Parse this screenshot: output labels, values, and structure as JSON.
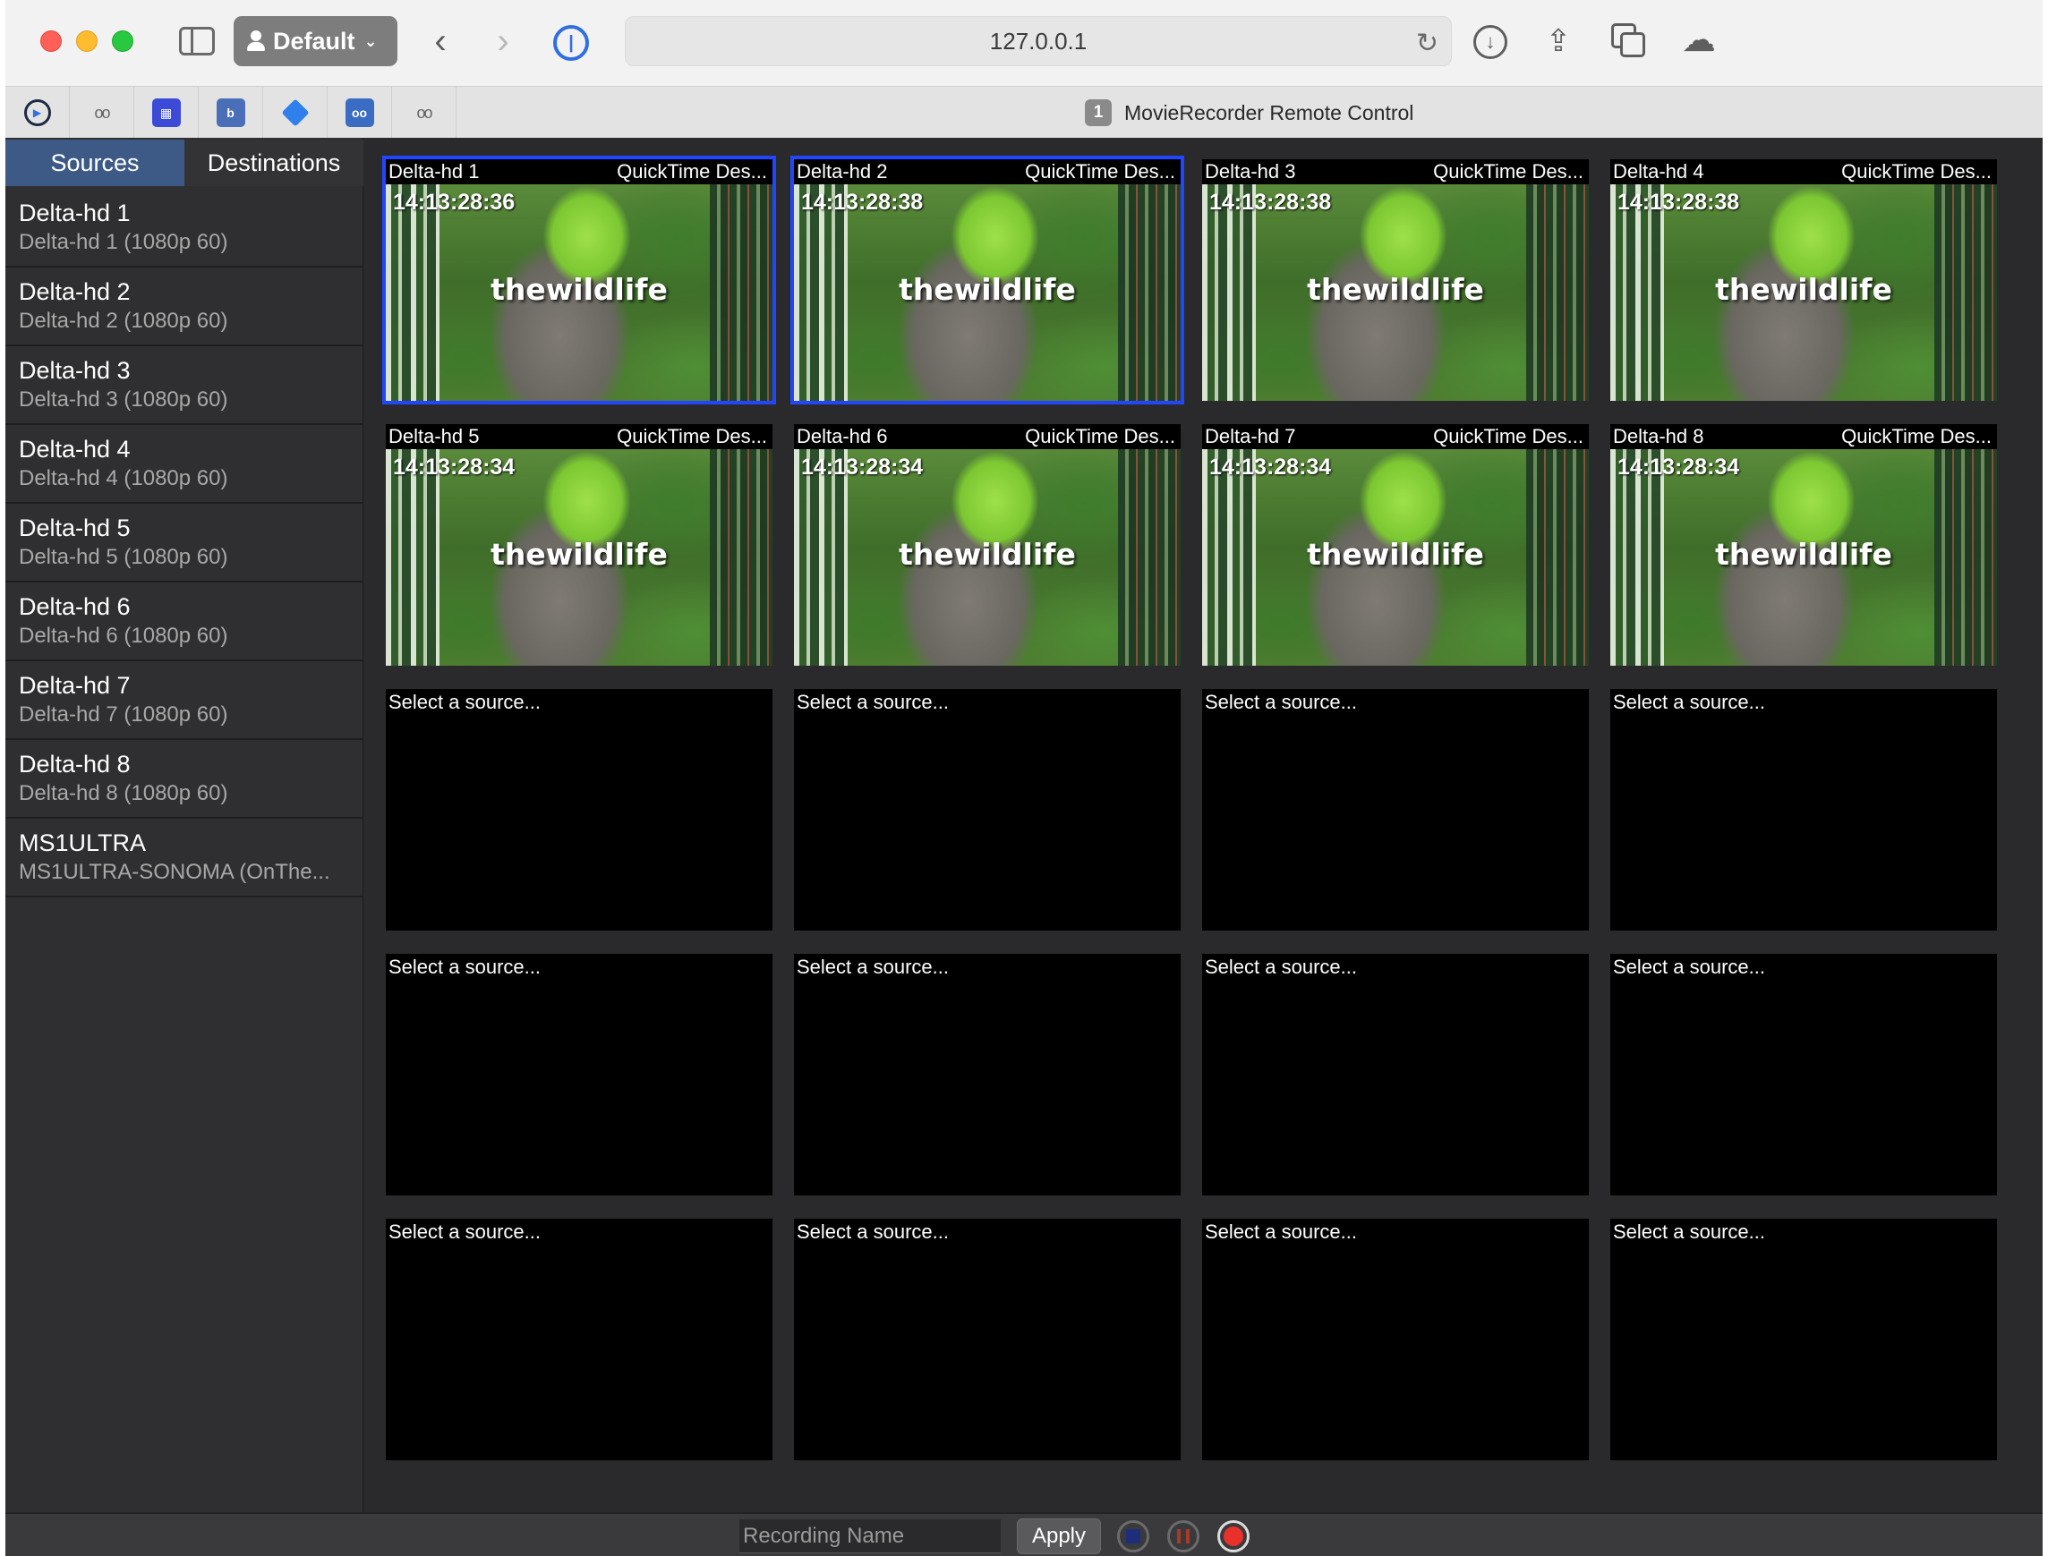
{
  "browser": {
    "profile": "Default",
    "url": "127.0.0.1"
  },
  "tab": {
    "badge": "1",
    "title": "MovieRecorder Remote Control"
  },
  "pinned_tabs": [
    {
      "icon": "play-circle-icon"
    },
    {
      "icon": "dots-icon"
    },
    {
      "icon": "grid-app-icon"
    },
    {
      "icon": "b-app-icon"
    },
    {
      "icon": "diamond-icon"
    },
    {
      "icon": "dots-box-icon"
    },
    {
      "icon": "dots-icon"
    }
  ],
  "sidebar": {
    "tabs": {
      "sources": "Sources",
      "destinations": "Destinations"
    },
    "items": [
      {
        "name": "Delta-hd 1",
        "sub": "Delta-hd 1 (1080p 60)"
      },
      {
        "name": "Delta-hd 2",
        "sub": "Delta-hd 2 (1080p 60)"
      },
      {
        "name": "Delta-hd 3",
        "sub": "Delta-hd 3 (1080p 60)"
      },
      {
        "name": "Delta-hd 4",
        "sub": "Delta-hd 4 (1080p 60)"
      },
      {
        "name": "Delta-hd 5",
        "sub": "Delta-hd 5 (1080p 60)"
      },
      {
        "name": "Delta-hd 6",
        "sub": "Delta-hd 6 (1080p 60)"
      },
      {
        "name": "Delta-hd 7",
        "sub": "Delta-hd 7 (1080p 60)"
      },
      {
        "name": "Delta-hd 8",
        "sub": "Delta-hd 8 (1080p 60)"
      },
      {
        "name": "MS1ULTRA",
        "sub": "MS1ULTRA-SONOMA (OnThe..."
      }
    ]
  },
  "grid": {
    "active_cells": [
      {
        "source": "Delta-hd 1",
        "dest": "QuickTime Des...",
        "timecode": "14:13:28:36",
        "watermark": "thewildlife",
        "selected": true
      },
      {
        "source": "Delta-hd 2",
        "dest": "QuickTime Des...",
        "timecode": "14:13:28:38",
        "watermark": "thewildlife",
        "selected": true
      },
      {
        "source": "Delta-hd 3",
        "dest": "QuickTime Des...",
        "timecode": "14:13:28:38",
        "watermark": "thewildlife",
        "selected": false
      },
      {
        "source": "Delta-hd 4",
        "dest": "QuickTime Des...",
        "timecode": "14:13:28:38",
        "watermark": "thewildlife",
        "selected": false
      },
      {
        "source": "Delta-hd 5",
        "dest": "QuickTime Des...",
        "timecode": "14:13:28:34",
        "watermark": "thewildlife",
        "selected": false
      },
      {
        "source": "Delta-hd 6",
        "dest": "QuickTime Des...",
        "timecode": "14:13:28:34",
        "watermark": "thewildlife",
        "selected": false
      },
      {
        "source": "Delta-hd 7",
        "dest": "QuickTime Des...",
        "timecode": "14:13:28:34",
        "watermark": "thewildlife",
        "selected": false
      },
      {
        "source": "Delta-hd 8",
        "dest": "QuickTime Des...",
        "timecode": "14:13:28:34",
        "watermark": "thewildlife",
        "selected": false
      }
    ],
    "empty_label": "Select a source...",
    "empty_count": 12
  },
  "bottom": {
    "recording_placeholder": "Recording Name",
    "apply_label": "Apply"
  },
  "colors": {
    "accent": "#3d5a86",
    "selection": "#2246ff",
    "record": "#e8312a"
  }
}
